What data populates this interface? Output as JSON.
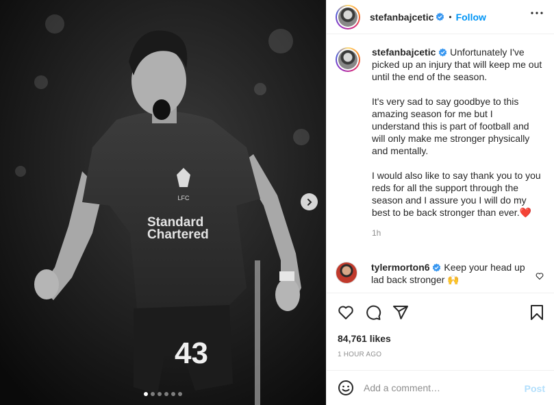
{
  "post": {
    "username": "stefanbajcetic",
    "follow_label": "Follow",
    "separator": "•",
    "caption_paragraphs": [
      "Unfortunately I've picked up an injury that will keep me out until the end of the season.",
      "It's very sad to say goodbye to this amazing season for me but I understand this is part of football and will only make me stronger physically and mentally.",
      "I would also like to say thank you to you reds for all the support through the season and I assure you I will do my best to be back stronger than ever."
    ],
    "caption_emoji": "❤️",
    "caption_time": "1h",
    "likes": "84,761 likes",
    "date": "1 HOUR AGO"
  },
  "comment": {
    "username": "tylermorton6",
    "text": "Keep your head up lad back stronger",
    "emoji": "🙌"
  },
  "add_comment": {
    "placeholder": "Add a comment…",
    "post_label": "Post"
  },
  "image": {
    "shirt_sponsor_line1": "Standard",
    "shirt_sponsor_line2": "Chartered",
    "crest_text": "LFC",
    "shirt_number": "43"
  },
  "carousel": {
    "count": 6,
    "active_index": 0
  },
  "icons": {
    "verified": "verified-badge-icon",
    "more": "more-options-icon",
    "like": "heart-icon",
    "comment": "comment-bubble-icon",
    "share": "paper-plane-icon",
    "save": "bookmark-icon",
    "emoji": "emoji-smiley-icon",
    "next": "chevron-right-icon"
  },
  "colors": {
    "accent": "#0095f6",
    "post_disabled": "#b2dffc",
    "verified": "#3897f0",
    "secondary_text": "#8e8e8e"
  }
}
